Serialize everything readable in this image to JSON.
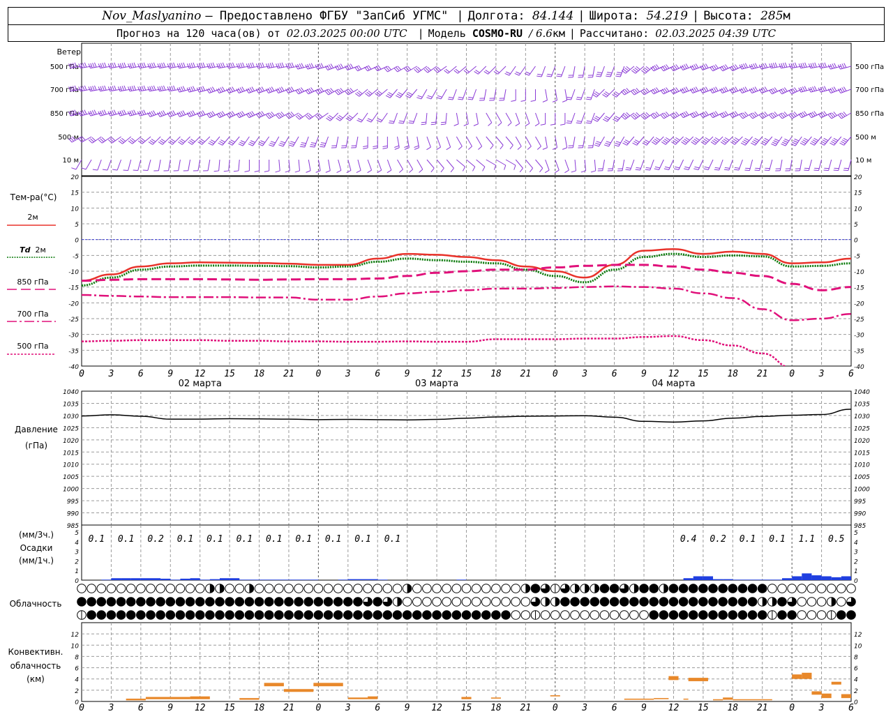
{
  "header": {
    "station": "Nov_Maslyanino",
    "provider": "— Предоставлено ФГБУ \"ЗапСиб УГМС\"",
    "lon_label": "Долгота:",
    "lon": "84.144",
    "lat_label": "Широта:",
    "lat": "54.219",
    "alt_label": "Высота:",
    "alt": "285",
    "alt_unit": "м",
    "forecast_label": "Прогноз на 120 часа(ов) от",
    "forecast_start": "02.03.2025 00:00 UTC",
    "model_label": "Модель",
    "model": "COSMO-RU",
    "model_res": "/ 6.6",
    "model_res_unit": "км",
    "calc_label": "Рассчитано:",
    "calc_time": "02.03.2025 04:39 UTC"
  },
  "labels": {
    "wind": "Ветер",
    "wind_levels": [
      "500 гПа",
      "700 гПа",
      "850 гПа",
      "500 м",
      "10  м"
    ],
    "temp": "Тем-ра(°С)",
    "t2m": "2м",
    "td": "Td",
    "td2m": "2м",
    "t850": "850 гПа",
    "t700": "700 гПа",
    "t500": "500 гПа",
    "pressure": "Давление",
    "pressure_unit": "(гПа)",
    "precip_unit3": "(мм/3ч.)",
    "precip": "Осадки",
    "precip_unit1": "(мм/1ч.)",
    "cloud": "Облачность",
    "conv_1": "Конвективн.",
    "conv_2": "облачность",
    "conv_3": "(км)"
  },
  "colors": {
    "t2m": "#e8322a",
    "td2m": "#0a7a0a",
    "upper": "#e0107a",
    "wind": "#8a3ad6",
    "precip": "#1f3fe0",
    "conv": "#e8882a",
    "zero_line": "#3a3ad6"
  },
  "chart_data": {
    "type": "line",
    "x_hours_ticks": [
      "0",
      "3",
      "6",
      "9",
      "12",
      "15",
      "18",
      "21",
      "0",
      "3",
      "6",
      "9",
      "12",
      "15",
      "18",
      "21",
      "0",
      "3",
      "6",
      "9",
      "12",
      "15",
      "18",
      "21",
      "0",
      "3",
      "6"
    ],
    "day_labels": [
      "02 марта",
      "03 марта",
      "04 марта"
    ],
    "temperature": {
      "ylim": [
        -40,
        20
      ],
      "yticks": [
        "20",
        "15",
        "10",
        "5",
        "0",
        "-5",
        "-10",
        "-15",
        "-20",
        "-25",
        "-30",
        "-35",
        "-40"
      ],
      "hours": [
        0,
        3,
        6,
        9,
        12,
        15,
        18,
        21,
        24,
        27,
        30,
        33,
        36,
        39,
        42,
        45,
        48,
        51,
        54,
        57,
        60,
        63,
        66,
        69,
        72,
        75,
        78
      ],
      "series": [
        {
          "name": "2м",
          "values": [
            -13,
            -11,
            -8.5,
            -7.5,
            -7.2,
            -7.3,
            -7.4,
            -7.6,
            -8,
            -8,
            -6,
            -4.5,
            -4.8,
            -5.5,
            -6.5,
            -8.5,
            -10,
            -12,
            -8,
            -3.5,
            -3,
            -4.5,
            -3.8,
            -4.5,
            -7.5,
            -7.2,
            -6
          ]
        },
        {
          "name": "Td 2м",
          "values": [
            -14.5,
            -12,
            -9.5,
            -8.5,
            -8.2,
            -8.2,
            -8.3,
            -8.4,
            -8.8,
            -8.5,
            -7,
            -6,
            -6.5,
            -7,
            -7.5,
            -9.5,
            -11.5,
            -13.5,
            -9.5,
            -5.5,
            -4.5,
            -5.5,
            -5,
            -5.3,
            -8.5,
            -8.3,
            -7.5
          ]
        },
        {
          "name": "850 гПа",
          "values": [
            -13,
            -12.7,
            -12.5,
            -12.5,
            -12.5,
            -12.6,
            -12.7,
            -12.6,
            -12.5,
            -12.5,
            -12.3,
            -11.5,
            -10.5,
            -10,
            -9.5,
            -9.5,
            -8.8,
            -8.3,
            -8,
            -8,
            -8.5,
            -9.5,
            -10.5,
            -11.5,
            -14,
            -16,
            -15
          ]
        },
        {
          "name": "700 гПа",
          "values": [
            -17.5,
            -17.8,
            -18,
            -18.2,
            -18.2,
            -18.2,
            -18.3,
            -18.3,
            -19,
            -19,
            -18,
            -17,
            -16.5,
            -16,
            -15.5,
            -15.5,
            -15.3,
            -15,
            -14.8,
            -15,
            -15.5,
            -17,
            -18.5,
            -22,
            -25.5,
            -25,
            -23.5
          ]
        },
        {
          "name": "500 гПа",
          "values": [
            -32.2,
            -32,
            -31.8,
            -31.8,
            -31.8,
            -32,
            -32,
            -32.2,
            -32.2,
            -32.3,
            -32.3,
            -32.2,
            -32.3,
            -32.3,
            -31.5,
            -31.5,
            -31.5,
            -31.3,
            -31.3,
            -30.8,
            -30.5,
            -31.8,
            -33.5,
            -36,
            -40.5,
            -45,
            -48
          ]
        }
      ]
    },
    "pressure": {
      "ylim": [
        985,
        1040
      ],
      "yticks": [
        "1040",
        "1035",
        "1030",
        "1025",
        "1020",
        "1015",
        "1010",
        "1005",
        "1000",
        "995",
        "990",
        "985"
      ],
      "hours": [
        0,
        3,
        6,
        9,
        12,
        15,
        18,
        21,
        24,
        27,
        30,
        33,
        36,
        39,
        42,
        45,
        48,
        51,
        54,
        57,
        60,
        63,
        66,
        69,
        72,
        75,
        78
      ],
      "values": [
        1029.8,
        1030.3,
        1029.7,
        1028.5,
        1028.5,
        1028.7,
        1028.6,
        1028.5,
        1028.3,
        1028.4,
        1028.3,
        1028.2,
        1028.4,
        1028.9,
        1029.4,
        1029.7,
        1029.8,
        1029.9,
        1029.3,
        1027.6,
        1027.3,
        1027.8,
        1028.9,
        1029.6,
        1030.1,
        1030.4,
        1032.6
      ]
    },
    "precipitation": {
      "ylim": [
        0,
        5
      ],
      "yticks": [
        "5",
        "4",
        "3",
        "2",
        "1",
        "0"
      ],
      "labels_3h": [
        "0.1",
        "0.1",
        "0.2",
        "0.1",
        "0.1",
        "0.1",
        "0.1",
        "0.1",
        "0.1",
        "0.1",
        "0.1",
        "",
        "",
        "",
        "",
        "",
        "",
        "",
        "",
        "",
        "0.4",
        "0.2",
        "0.1",
        "0.1",
        "1.1",
        "0.5"
      ],
      "hourly_hours": [
        3,
        4,
        5,
        6,
        7,
        8,
        9,
        10,
        11,
        12,
        13,
        14,
        15,
        16,
        17,
        18,
        19,
        20,
        21,
        22,
        23,
        24,
        27,
        28,
        29,
        30,
        31,
        39,
        62,
        63,
        64,
        65,
        66,
        67,
        68,
        69,
        70,
        71,
        72,
        73,
        74,
        75,
        76,
        77,
        78
      ],
      "hourly_values": [
        0.05,
        0.2,
        0.2,
        0.2,
        0.2,
        0.2,
        0.15,
        0.05,
        0.15,
        0.2,
        0.05,
        0.1,
        0.2,
        0.2,
        0.05,
        0.05,
        0.05,
        0.05,
        0.05,
        0.05,
        0.05,
        0.05,
        0.05,
        0.1,
        0.1,
        0.1,
        0.05,
        0.05,
        0.2,
        0.4,
        0.4,
        0.1,
        0.1,
        0.05,
        0.05,
        0.05,
        0.05,
        0.05,
        0.2,
        0.4,
        0.7,
        0.5,
        0.4,
        0.3,
        0.4
      ]
    },
    "convective": {
      "ylim": [
        0,
        14
      ],
      "yticks": [
        "12",
        "10",
        "8",
        "6",
        "4",
        "2",
        "0"
      ],
      "segments": [
        {
          "h0": 4.5,
          "h1": 6.5,
          "base": 0.2,
          "top": 0.5
        },
        {
          "h0": 6.5,
          "h1": 11,
          "base": 0.4,
          "top": 0.8
        },
        {
          "h0": 11,
          "h1": 13,
          "base": 0.4,
          "top": 0.9
        },
        {
          "h0": 16,
          "h1": 18,
          "base": 0.3,
          "top": 0.6
        },
        {
          "h0": 18.5,
          "h1": 20.5,
          "base": 2.7,
          "top": 3.3
        },
        {
          "h0": 20.5,
          "h1": 23.5,
          "base": 1.7,
          "top": 2.2
        },
        {
          "h0": 23.5,
          "h1": 26.5,
          "base": 2.7,
          "top": 3.3
        },
        {
          "h0": 27,
          "h1": 29,
          "base": 0.4,
          "top": 0.7
        },
        {
          "h0": 29,
          "h1": 30,
          "base": 0.4,
          "top": 0.9
        },
        {
          "h0": 38.5,
          "h1": 39.5,
          "base": 0.4,
          "top": 0.8
        },
        {
          "h0": 41.5,
          "h1": 42.5,
          "base": 0.5,
          "top": 0.7
        },
        {
          "h0": 47.5,
          "h1": 48.5,
          "base": 0.9,
          "top": 1.1
        },
        {
          "h0": 55,
          "h1": 58,
          "base": 0.3,
          "top": 0.5
        },
        {
          "h0": 58,
          "h1": 59.5,
          "base": 0.4,
          "top": 0.6
        },
        {
          "h0": 59.5,
          "h1": 60.5,
          "base": 3.8,
          "top": 4.5
        },
        {
          "h0": 61,
          "h1": 61.5,
          "base": 0.4,
          "top": 0.5
        },
        {
          "h0": 61.5,
          "h1": 63.5,
          "base": 3.6,
          "top": 4.2
        },
        {
          "h0": 64,
          "h1": 65,
          "base": 0.2,
          "top": 0.4
        },
        {
          "h0": 65,
          "h1": 66,
          "base": 0.3,
          "top": 0.7
        },
        {
          "h0": 66,
          "h1": 70,
          "base": 0.3,
          "top": 0.4
        },
        {
          "h0": 72,
          "h1": 73,
          "base": 4,
          "top": 4.8
        },
        {
          "h0": 73,
          "h1": 74,
          "base": 4,
          "top": 5.1
        },
        {
          "h0": 74,
          "h1": 75,
          "base": 1.2,
          "top": 1.8
        },
        {
          "h0": 75,
          "h1": 76,
          "base": 0.6,
          "top": 1.4
        },
        {
          "h0": 76,
          "h1": 77,
          "base": 3,
          "top": 3.5
        },
        {
          "h0": 77,
          "h1": 78,
          "base": 0.6,
          "top": 1.3
        }
      ]
    },
    "cloudiness": {
      "rows": [
        "high",
        "middle",
        "low"
      ],
      "encoding": "0=clear,1=quarter,2=half,3=three-quarter,4=overcast",
      "high": "0000000000000000003101000000000000000000000000000000000000000000000000000002431322222213444444212200000000001111111101",
      "middle": "4444444444444444444444444444444444444444444444444444444444444444444444444444444444444444444444444444444444444",
      "low": "1444444444444444444444444444444444444444444444444444444444444444444444444444444444444444444444444444444444444"
    },
    "wind": {
      "levels": [
        "500 гПа",
        "700 гПа",
        "850 гПа",
        "500 м",
        "10  м"
      ],
      "note": "wind barbs"
    }
  }
}
